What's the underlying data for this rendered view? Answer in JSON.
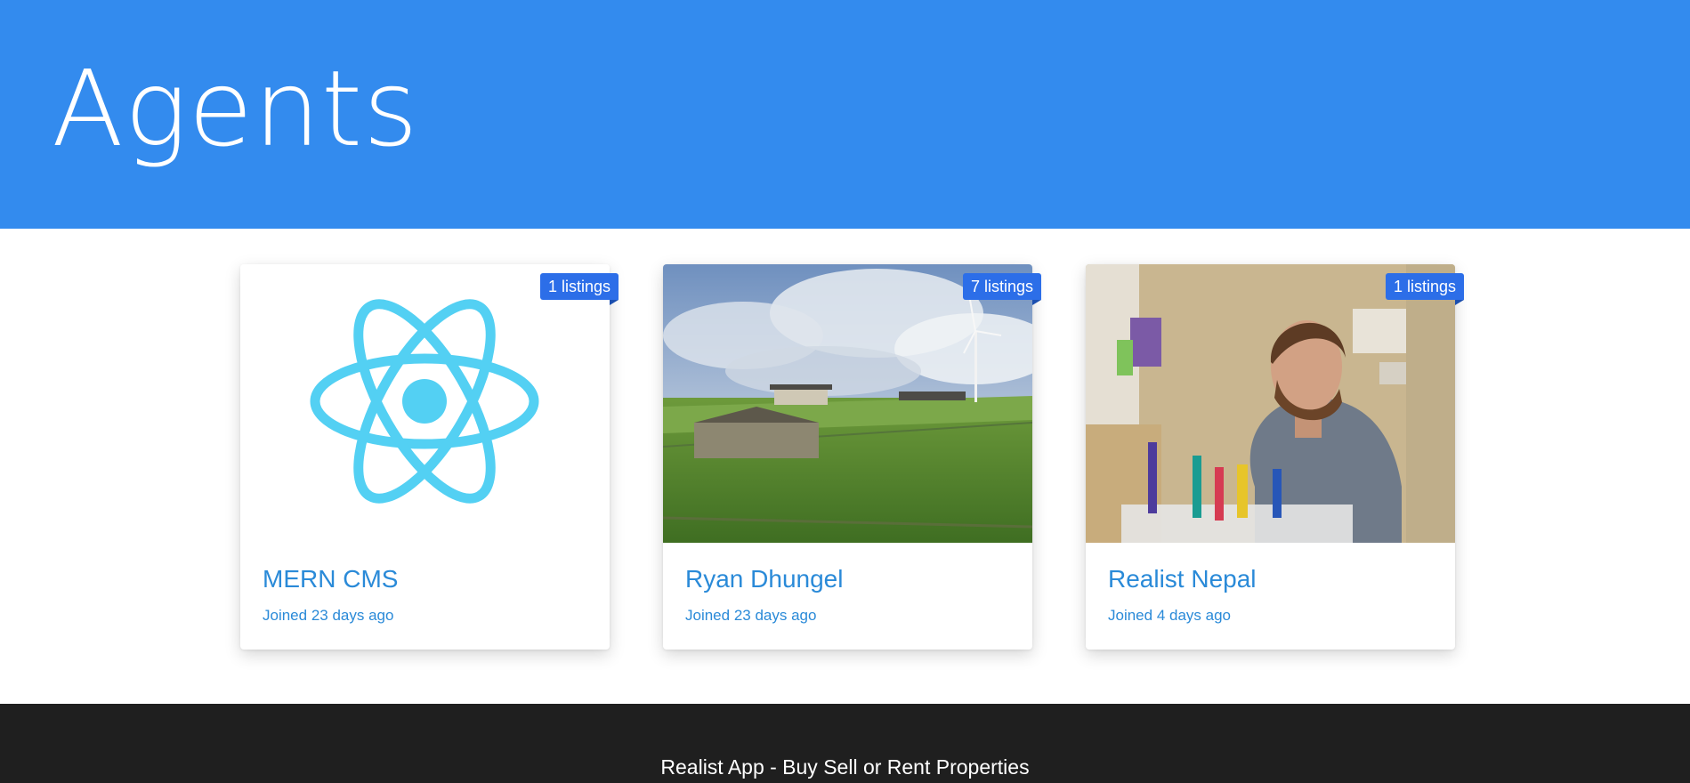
{
  "header": {
    "title": "Agents"
  },
  "agents": [
    {
      "name": "MERN CMS",
      "joined": "Joined 23 days ago",
      "listings": "1 listings",
      "image_icon": "react-logo-icon"
    },
    {
      "name": "Ryan Dhungel",
      "joined": "Joined 23 days ago",
      "listings": "7 listings",
      "image_icon": "countryside-photo"
    },
    {
      "name": "Realist Nepal",
      "joined": "Joined 4 days ago",
      "listings": "1 listings",
      "image_icon": "person-at-desk-photo"
    }
  ],
  "footer": {
    "text": "Realist App - Buy Sell or Rent Properties"
  },
  "colors": {
    "hero": "#338bee",
    "link": "#2a8ad8",
    "badge": "#2c6ee8",
    "footer": "#1f1f1f",
    "react": "#53d0f3"
  }
}
